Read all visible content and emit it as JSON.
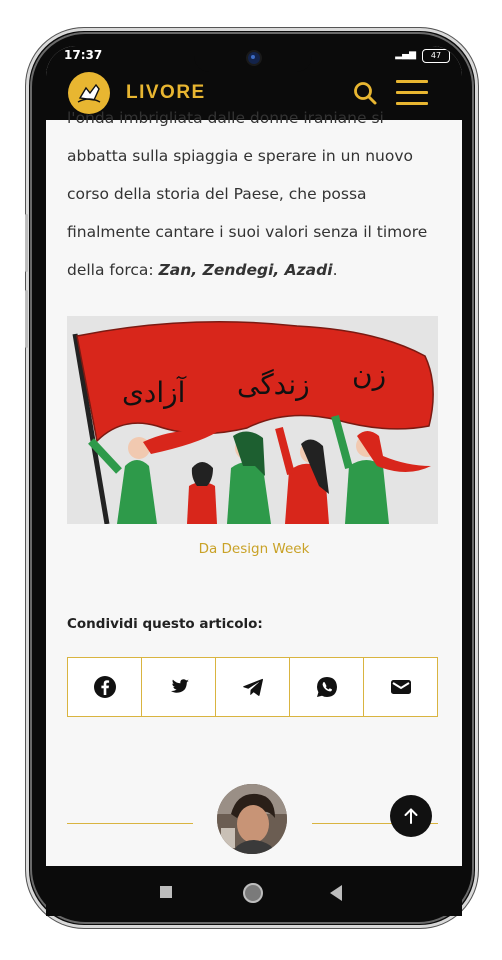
{
  "status_bar": {
    "time": "17:37",
    "battery": "47"
  },
  "header": {
    "brand": "LIVORE"
  },
  "article": {
    "lines": [
      "l'onda imbrigliata dalle donne iraniane si",
      "abbatta sulla spiaggia e sperare in un nuovo",
      "corso della storia del Paese, che possa",
      "finalmente cantare i suoi valori senza il timore"
    ],
    "last_line_prefix": "della forca: ",
    "last_line_emphasis": "Zan, Zendegi, Azadi",
    "last_line_suffix": "."
  },
  "image": {
    "flag_text": [
      "زن",
      "زندگی",
      "آزادی"
    ],
    "colors": {
      "flag": "#d8261b",
      "green": "#2e9a4a",
      "bg": "#e4e4e4"
    }
  },
  "caption": "Da Design Week",
  "share": {
    "label": "Condividi questo articolo:",
    "buttons": [
      "facebook",
      "twitter",
      "telegram",
      "whatsapp",
      "email"
    ]
  },
  "colors": {
    "accent": "#e8b631",
    "border": "#d9b440",
    "caption": "#c9a227"
  }
}
